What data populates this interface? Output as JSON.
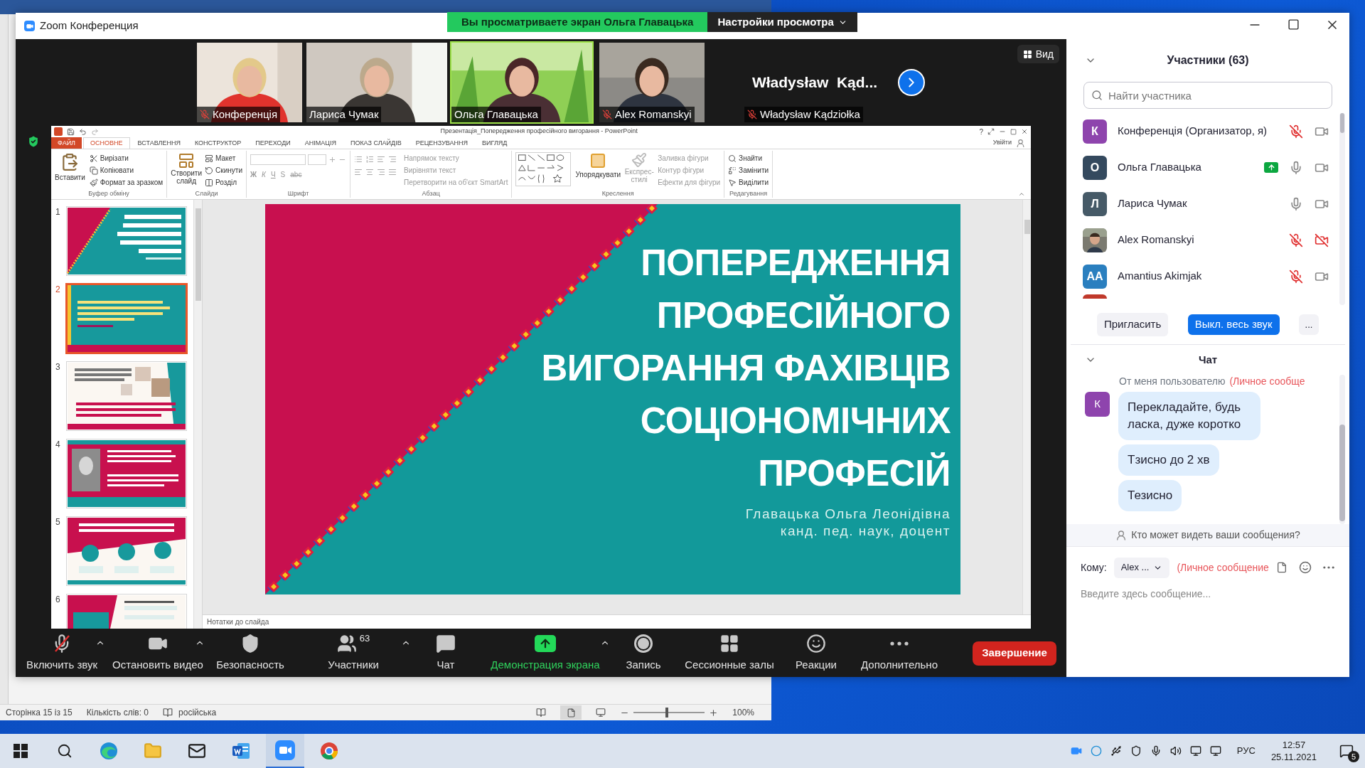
{
  "word": {
    "status": {
      "page": "Сторінка 15 із 15",
      "words": "Кількість слів: 0",
      "language": "російська",
      "zoom": "100%",
      "zoom_slider": {
        "level": 0.47
      }
    }
  },
  "zoom": {
    "title": "Zoom Конференция",
    "share_banner": "Вы просматриваете экран Ольга Главацька",
    "view_settings": "Настройки просмотра",
    "view_button": "Вид",
    "videos": [
      {
        "kind": "video",
        "name": "Конференція",
        "muted": true,
        "speaking": false
      },
      {
        "kind": "video",
        "name": "Лариса Чумак",
        "muted": false,
        "speaking": false
      },
      {
        "kind": "video",
        "name": "Ольга Главацька",
        "muted": false,
        "speaking": true
      },
      {
        "kind": "video",
        "name": "Alex Romanskyi",
        "muted": true,
        "speaking": false
      },
      {
        "kind": "name_only",
        "name": "Władysław Kądziołka",
        "display_name": "Władysław  Kąd...",
        "muted": true,
        "speaking": false
      }
    ],
    "toolbar": {
      "items": [
        {
          "kind": "mic",
          "label": "Включить звук",
          "muted": true,
          "menu": true
        },
        {
          "kind": "video",
          "label": "Остановить видео",
          "menu": true
        },
        {
          "kind": "security",
          "label": "Безопасность",
          "menu": false
        },
        {
          "kind": "participants",
          "label": "Участники",
          "count": "63",
          "menu": true
        },
        {
          "kind": "chat",
          "label": "Чат",
          "menu": false
        },
        {
          "kind": "share",
          "label": "Демонстрация экрана",
          "menu": true
        },
        {
          "kind": "record",
          "label": "Запись",
          "menu": false
        },
        {
          "kind": "breakout",
          "label": "Сессионные залы",
          "menu": false
        },
        {
          "kind": "reactions",
          "label": "Реакции",
          "menu": false
        },
        {
          "kind": "more",
          "label": "Дополнительно",
          "menu": false
        }
      ],
      "end_button": "Завершение"
    },
    "participants": {
      "title": "Участники (63)",
      "search": {
        "placeholder": "Найти участника"
      },
      "list": [
        {
          "kind": "letter",
          "initial": "К",
          "color": "#8e44ad",
          "name": "Конференція (Организатор, я)",
          "muted": true,
          "video_off": false,
          "sharing": false
        },
        {
          "kind": "letter",
          "initial": "О",
          "color": "#34495e",
          "name": "Ольга Главацька",
          "muted": false,
          "video_off": false,
          "sharing": true
        },
        {
          "kind": "letter",
          "initial": "Л",
          "color": "#465a67",
          "name": "Лариса Чумак",
          "muted": false,
          "video_off": false,
          "sharing": false
        },
        {
          "name": "Alex Romanskyi",
          "muted": true,
          "video_off": true,
          "sharing": false
        },
        {
          "kind": "letter",
          "initial": "AA",
          "color": "#2a7fbf",
          "name": "Amantius Akimjak",
          "muted": true,
          "video_off": false,
          "sharing": false
        }
      ],
      "partial": {
        "color": "#c0392b"
      },
      "buttons": {
        "invite": "Пригласить",
        "mute_all": "Выкл. весь звук",
        "more": "..."
      }
    },
    "chat": {
      "title": "Чат",
      "meta": {
        "from": "От меня пользователю",
        "private": "(Личное сообще"
      },
      "avatar": {
        "initial": "К",
        "color": "#8e44ad"
      },
      "messages": [
        "Перекладайте, будь ласка, дуже коротко",
        "Тзисно до 2 хв",
        "Тезисно"
      ],
      "privacy_note": "Кто может видеть ваши сообщения?",
      "to_label": "Кому:",
      "recipient": "Alex ...",
      "private_label": "(Личное сообщение",
      "input": {
        "placeholder": "Введите здесь сообщение..."
      }
    }
  },
  "powerpoint": {
    "title": "Презентація_Попередження професійного вигорання - PowerPoint",
    "help": "?",
    "signin": "Увійти",
    "tabs": [
      {
        "label": "ФАЙЛ",
        "kind": "file",
        "selected": false
      },
      {
        "label": "ОСНОВНЕ",
        "kind": "tab",
        "selected": true
      },
      {
        "label": "ВСТАВЛЕННЯ",
        "kind": "tab",
        "selected": false
      },
      {
        "label": "КОНСТРУКТОР",
        "kind": "tab",
        "selected": false
      },
      {
        "label": "ПЕРЕХОДИ",
        "kind": "tab",
        "selected": false
      },
      {
        "label": "АНІМАЦІЯ",
        "kind": "tab",
        "selected": false
      },
      {
        "label": "ПОКАЗ СЛАЙДІВ",
        "kind": "tab",
        "selected": false
      },
      {
        "label": "РЕЦЕНЗУВАННЯ",
        "kind": "tab",
        "selected": false
      },
      {
        "label": "ВИГЛЯД",
        "kind": "tab",
        "selected": false
      }
    ],
    "groups": [
      {
        "kind": "clipboard",
        "label": "Буфер обміну",
        "commands": [
          "Вставити",
          "Вирізати",
          "Копіювати",
          "Формат за зразком"
        ]
      },
      {
        "kind": "slides",
        "label": "Слайди",
        "commands": [
          "Створити слайд",
          "Макет",
          "Скинути",
          "Розділ"
        ]
      },
      {
        "kind": "font",
        "label": "Шрифт",
        "commands": [
          "Ж",
          "К",
          "Ч",
          "S",
          "abc"
        ]
      },
      {
        "kind": "paragraph",
        "label": "Абзац",
        "commands": [
          "Напрямок тексту",
          "Вирівняти текст",
          "Перетворити на об'єкт SmartArt"
        ]
      },
      {
        "kind": "drawing",
        "label": "Креслення",
        "commands": [
          "Упорядкувати",
          "Експрес-стилі",
          "Заливка фігури",
          "Контур фігури",
          "Ефекти для фігури"
        ]
      },
      {
        "kind": "editing",
        "label": "Редагування",
        "commands": [
          "Знайти",
          "Замінити",
          "Виділити"
        ]
      }
    ],
    "thumbnails": [
      {
        "number": "1",
        "kind": "title",
        "selected": false
      },
      {
        "number": "2",
        "kind": "quote",
        "selected": true
      },
      {
        "number": "3",
        "kind": "collage",
        "selected": false
      },
      {
        "number": "4",
        "kind": "portrait",
        "selected": false
      },
      {
        "number": "5",
        "kind": "icons",
        "selected": false
      },
      {
        "number": "6",
        "kind": "split",
        "selected": false
      }
    ],
    "slide": {
      "title": [
        "ПОПЕРЕДЖЕННЯ",
        "ПРОФЕСІЙНОГО",
        "ВИГОРАННЯ ФАХІВЦІВ",
        "СОЦІОНОМІЧНИХ",
        "ПРОФЕСІЙ"
      ],
      "subtitle": [
        "Главацька Ольга Леонідівна",
        "канд. пед. наук, доцент"
      ]
    },
    "notes": "Нотатки до слайда"
  },
  "taskbar": {
    "apps": [
      {
        "kind": "start",
        "selected": false
      },
      {
        "kind": "search",
        "selected": false
      },
      {
        "kind": "edge",
        "selected": false
      },
      {
        "kind": "explorer",
        "selected": false
      },
      {
        "kind": "mail",
        "selected": false
      },
      {
        "kind": "word",
        "selected": false
      },
      {
        "kind": "zoom",
        "selected": true
      },
      {
        "kind": "chrome",
        "selected": false
      }
    ],
    "language": "РУС",
    "time": "12:57",
    "date": "25.11.2021",
    "notifications": "5"
  }
}
